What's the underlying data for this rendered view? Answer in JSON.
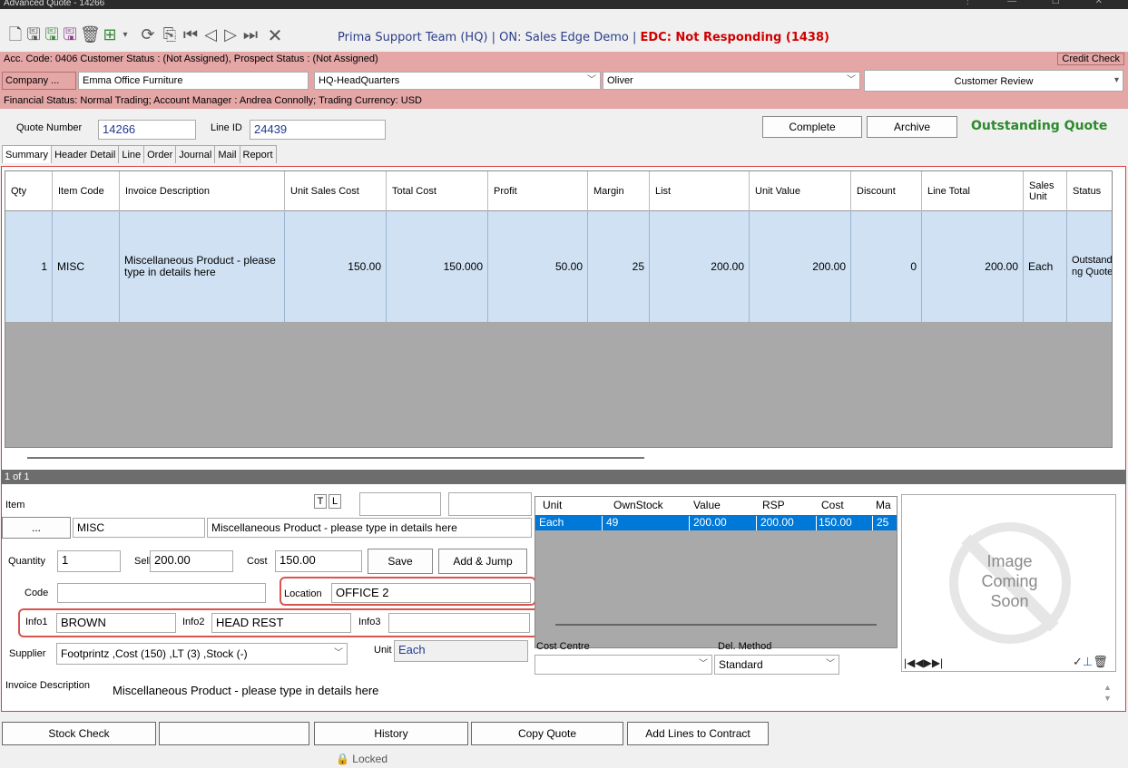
{
  "window": {
    "title": "Advanced Quote - 14266",
    "controls": [
      "⋮",
      "—",
      "☐",
      "✕"
    ]
  },
  "toolbar": {
    "status_prefix": "Prima Support Team (HQ) | ON: Sales Edge Demo |",
    "edc_status": "EDC: Not Responding (1438)"
  },
  "account": {
    "info": "Acc. Code: 0406  Customer Status : (Not Assigned), Prospect Status : (Not Assigned)",
    "credit_check": "Credit Check",
    "company_btn": "Company ...",
    "company": "Emma Office Furniture",
    "site": "HQ-HeadQuarters",
    "contact": "Oliver",
    "review": "Customer Review",
    "financial": "Financial Status: Normal Trading;  Account Manager : Andrea Connolly; Trading Currency: USD"
  },
  "quote": {
    "number_label": "Quote Number",
    "number": "14266",
    "line_label": "Line ID",
    "line_id": "24439",
    "complete": "Complete",
    "archive": "Archive",
    "status": "Outstanding Quote"
  },
  "tabs": [
    "Summary",
    "Header Detail",
    "Line",
    "Order",
    "Journal",
    "Mail",
    "Report"
  ],
  "grid": {
    "headers": [
      "Qty",
      "Item Code",
      "Invoice Description",
      "Unit Sales Cost",
      "Total Cost",
      "Profit",
      "Margin",
      "List",
      "Unit Value",
      "Discount",
      "Line Total",
      "Sales Unit",
      "Status"
    ],
    "row": [
      "1",
      "MISC",
      "Miscellaneous Product  - please type in details here",
      "150.00",
      "150.000",
      "50.00",
      "25",
      "200.00",
      "200.00",
      "0",
      "200.00",
      "Each",
      "Outstanding Quote"
    ],
    "pager": "1 of 1"
  },
  "item": {
    "label": "Item",
    "t": "T",
    "l": "L",
    "ellipsis": "...",
    "code": "MISC",
    "description": "Miscellaneous Product  - please type in details here",
    "quantity_label": "Quantity",
    "quantity": "1",
    "sell_label": "Sell",
    "sell": "200.00",
    "cost_label": "Cost",
    "cost": "150.00",
    "save": "Save",
    "add_jump": "Add & Jump",
    "code_label": "Code",
    "code_value": "",
    "location_label": "Location",
    "location": "OFFICE 2",
    "info1_label": "Info1",
    "info1": "BROWN",
    "info2_label": "Info2",
    "info2": "HEAD REST",
    "info3_label": "Info3",
    "info3": "",
    "supplier_label": "Supplier",
    "supplier": "Footprintz  ,Cost (150)  ,LT (3)  ,Stock (-)",
    "unit_label": "Unit",
    "unit": "Each",
    "invoice_desc_label": "Invoice Description",
    "invoice_desc": "Miscellaneous Product  - please type in details here"
  },
  "stock": {
    "headers": [
      "Unit",
      "OwnStock",
      "Value",
      "RSP",
      "Cost",
      "Ma"
    ],
    "row": [
      "Each",
      "49",
      "200.00",
      "200.00",
      "150.00",
      "25"
    ],
    "cost_centre_label": "Cost Centre",
    "del_method_label": "Del. Method",
    "del_method": "Standard"
  },
  "image": {
    "placeholder": [
      "Image",
      "Coming",
      "Soon"
    ]
  },
  "bottom": {
    "stock_check": "Stock Check",
    "blank": "",
    "history": "History",
    "copy_quote": "Copy Quote",
    "add_lines": "Add Lines to Contract",
    "locked": "Locked"
  }
}
